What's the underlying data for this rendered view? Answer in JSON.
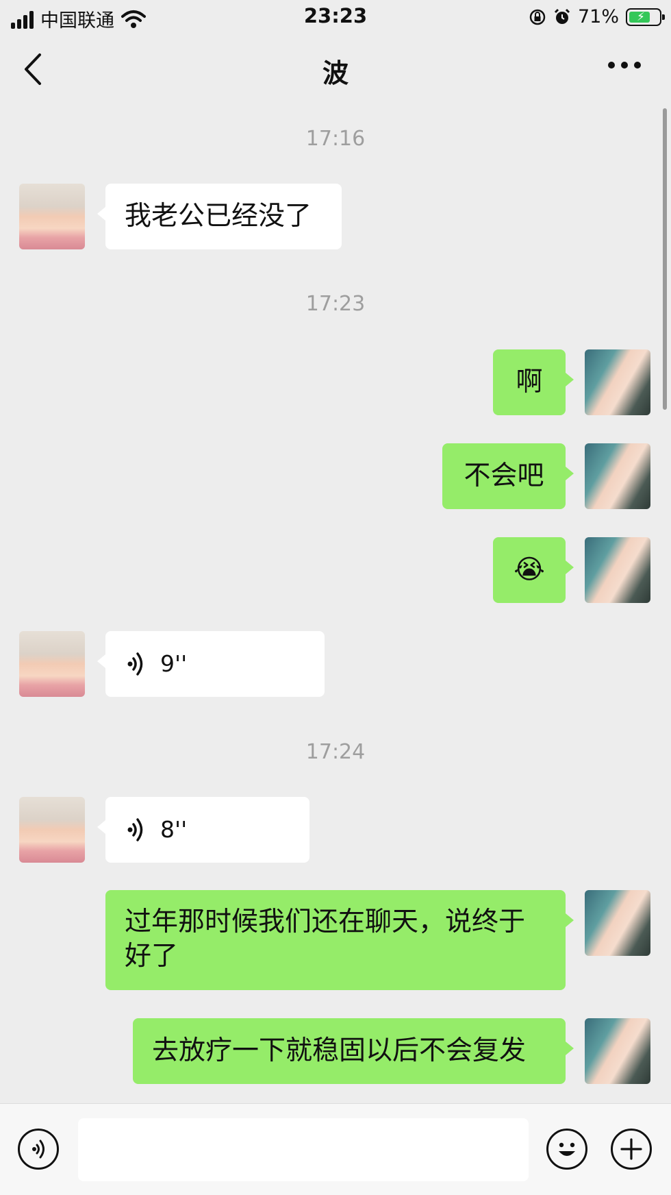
{
  "status_bar": {
    "carrier": "中国联通",
    "time": "23:23",
    "battery": "71%",
    "battery_level": 0.71
  },
  "header": {
    "title": "波"
  },
  "messages": [
    {
      "type": "time",
      "text": "17:16"
    },
    {
      "type": "text",
      "side": "in",
      "text": "我老公已经没了"
    },
    {
      "type": "time",
      "text": "17:23"
    },
    {
      "type": "text",
      "side": "out",
      "text": "啊"
    },
    {
      "type": "text",
      "side": "out",
      "text": "不会吧"
    },
    {
      "type": "emoji",
      "side": "out",
      "text": "😭"
    },
    {
      "type": "voice",
      "side": "in",
      "text": "9''"
    },
    {
      "type": "time",
      "text": "17:24"
    },
    {
      "type": "voice",
      "side": "in",
      "text": "8''"
    },
    {
      "type": "text",
      "side": "out",
      "text": "过年那时候我们还在聊天，说终于好了"
    },
    {
      "type": "text",
      "side": "out",
      "text": "去放疗一下就稳固以后不会复发"
    }
  ],
  "colors": {
    "background": "#ededed",
    "sent_bubble": "#95ec69",
    "received_bubble": "#ffffff",
    "timestamp": "#9e9e9e"
  }
}
